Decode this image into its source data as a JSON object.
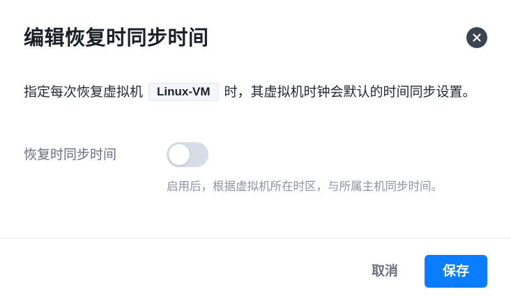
{
  "dialog": {
    "title": "编辑恢复时同步时间",
    "close_icon": "close-icon",
    "description": {
      "prefix": "指定每次恢复虚拟机",
      "vm_name": "Linux-VM",
      "suffix": "时，其虚拟机时钟会默认的时间同步设置。"
    },
    "setting": {
      "label": "恢复时同步时间",
      "toggle_on": false,
      "hint": "启用后，根据虚拟机所在时区，与所属主机同步时间。"
    },
    "footer": {
      "cancel_label": "取消",
      "save_label": "保存"
    }
  },
  "colors": {
    "primary": "#0a7cff",
    "toggle_off": "#d7dde6",
    "close_bg": "#3c4452"
  }
}
